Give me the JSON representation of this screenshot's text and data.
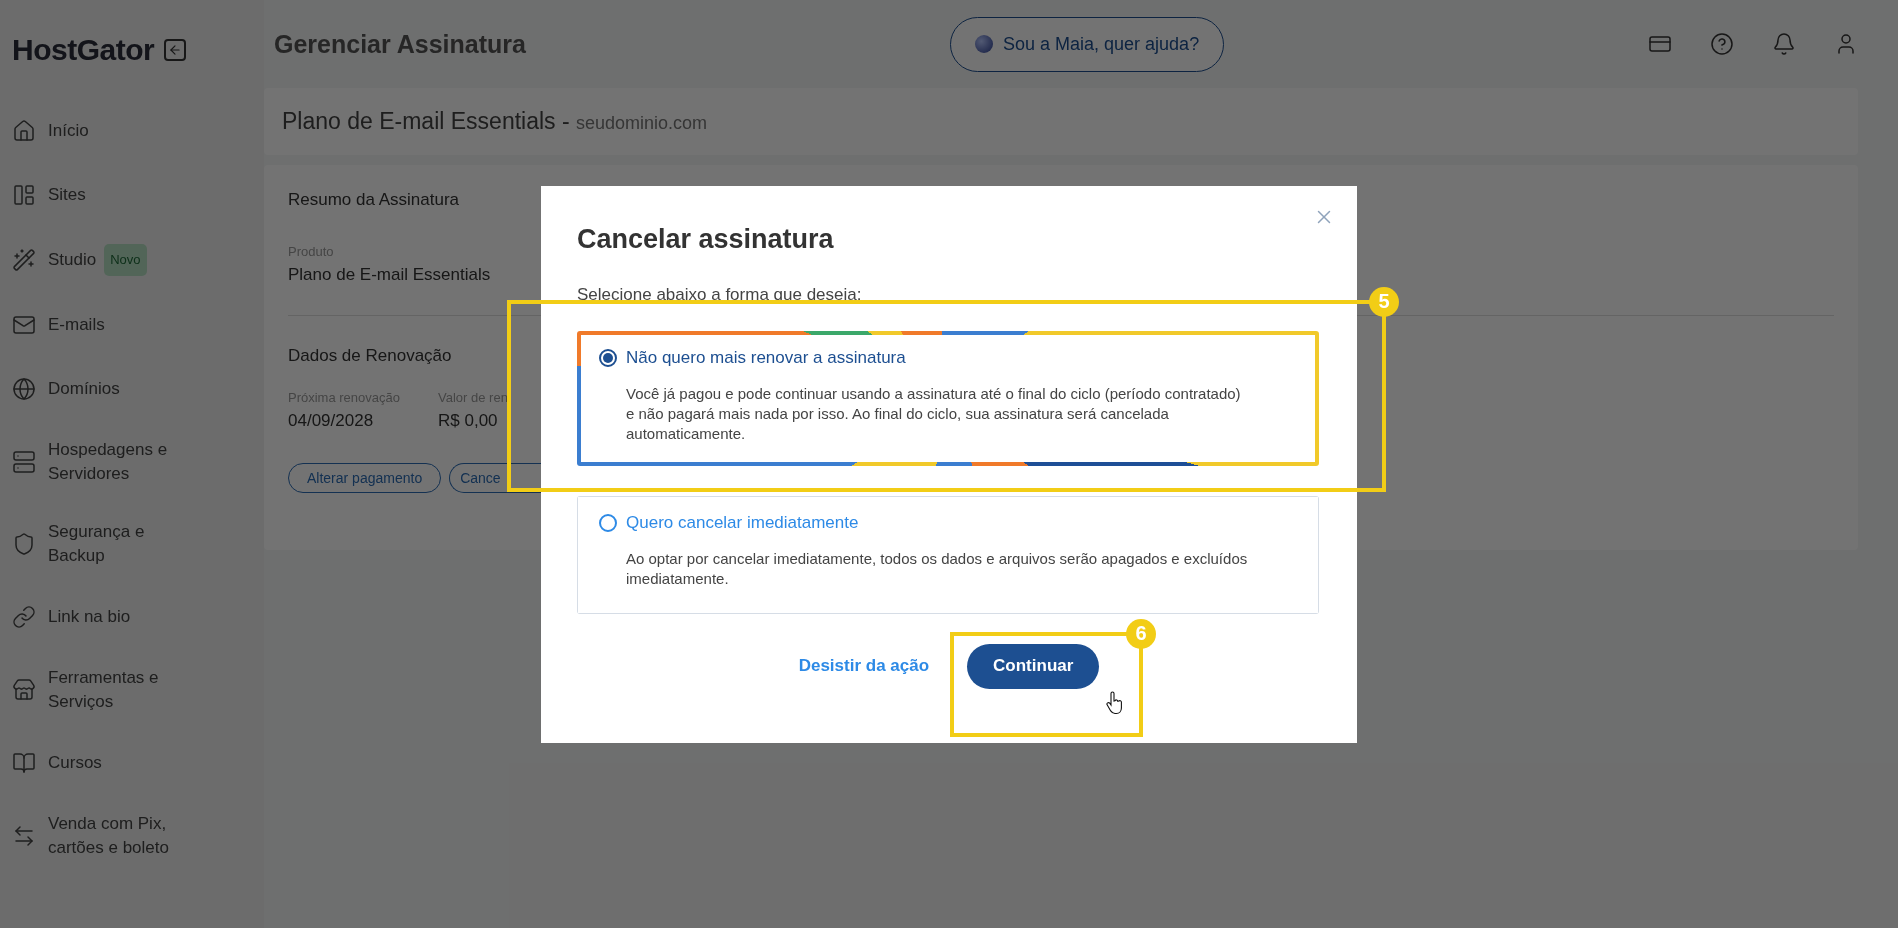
{
  "sidebar": {
    "logo": "HostGator",
    "items": [
      {
        "label": "Início"
      },
      {
        "label": "Sites"
      },
      {
        "label": "Studio",
        "badge": "Novo"
      },
      {
        "label": "E-mails"
      },
      {
        "label": "Domínios"
      },
      {
        "label": "Hospedagens e Servidores"
      },
      {
        "label": "Segurança e Backup"
      },
      {
        "label": "Link na bio"
      },
      {
        "label": "Ferramentas e Serviços"
      },
      {
        "label": "Cursos"
      },
      {
        "label": "Venda com Pix, cartões e boleto"
      }
    ]
  },
  "header": {
    "title": "Gerenciar Assinatura",
    "assistant_button": "Sou a Maia, quer ajuda?"
  },
  "plan_header": {
    "title": "Plano de E-mail Essentials - ",
    "domain": "seudominio.com"
  },
  "summary": {
    "title": "Resumo da Assinatura",
    "product_label": "Produto",
    "product": "Plano de E-mail Essentials",
    "renewal_title": "Dados de Renovação",
    "fields": [
      {
        "label": "Próxima renovação",
        "value": "04/09/2028"
      },
      {
        "label": "Valor de ren",
        "value": "R$ 0,00"
      }
    ],
    "buttons": [
      "Alterar pagamento",
      "Cance"
    ]
  },
  "modal": {
    "title": "Cancelar assinatura",
    "subtitle": "Selecione abaixo a forma que deseja:",
    "options": [
      {
        "label": "Não quero mais renovar a assinatura",
        "description": "Você já pagou e pode continuar usando a assinatura até o final do ciclo (período contratado) e não pagará mais nada por isso. Ao final do ciclo, sua assinatura será cancelada automaticamente.",
        "selected": true
      },
      {
        "label": "Quero cancelar imediatamente",
        "description": "Ao optar por cancelar imediatamente, todos os dados e arquivos serão apagados e excluídos imediatamente.",
        "selected": false
      }
    ],
    "cancel_link": "Desistir da ação",
    "confirm_button": "Continuar"
  },
  "annotations": [
    {
      "number": "5"
    },
    {
      "number": "6"
    }
  ]
}
